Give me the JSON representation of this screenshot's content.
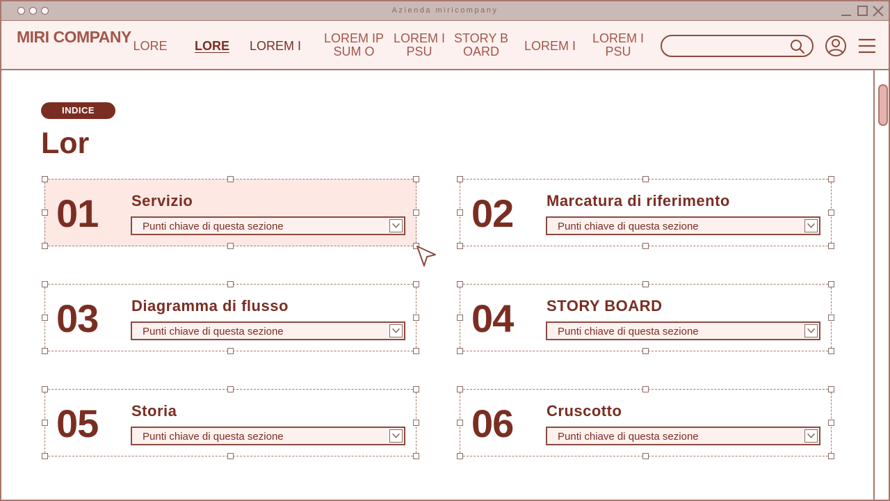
{
  "window": {
    "title": "Azienda miricompany"
  },
  "header": {
    "brand": "MIRI COMPANY",
    "nav": [
      {
        "label": "LORE"
      },
      {
        "label": "LORE"
      },
      {
        "label": "LOREM I"
      },
      {
        "label": "LOREM IPSUM O"
      },
      {
        "label": "LOREM IPSU"
      },
      {
        "label": "STORY BOARD"
      },
      {
        "label": "LOREM I"
      },
      {
        "label": "LOREM IPSU"
      }
    ],
    "search": {
      "value": "",
      "placeholder": ""
    },
    "icons": {
      "search": "search-icon",
      "user": "user-icon",
      "menu": "hamburger-menu-icon"
    }
  },
  "content": {
    "badge": "INDICE",
    "title": "Lor",
    "cards": [
      {
        "number": "01",
        "title": "Servizio",
        "dropdown": "Punti chiave di questa sezione",
        "selected": true
      },
      {
        "number": "02",
        "title": "Marcatura di riferimento",
        "dropdown": "Punti chiave di questa sezione",
        "selected": false
      },
      {
        "number": "03",
        "title": "Diagramma di flusso",
        "dropdown": "Punti chiave di questa sezione",
        "selected": false
      },
      {
        "number": "04",
        "title": "STORY BOARD",
        "dropdown": "Punti chiave di questa sezione",
        "selected": false
      },
      {
        "number": "05",
        "title": "Storia",
        "dropdown": "Punti chiave di questa sezione",
        "selected": false
      },
      {
        "number": "06",
        "title": "Cruscotto",
        "dropdown": "Punti chiave di questa sezione",
        "selected": false
      }
    ]
  },
  "colors": {
    "accent": "#7a2e22",
    "accent_light": "#a2564b",
    "header_bg": "#fdf1ef",
    "selected_bg": "#fde8e4",
    "titlebar_bg": "#c9bab8"
  }
}
